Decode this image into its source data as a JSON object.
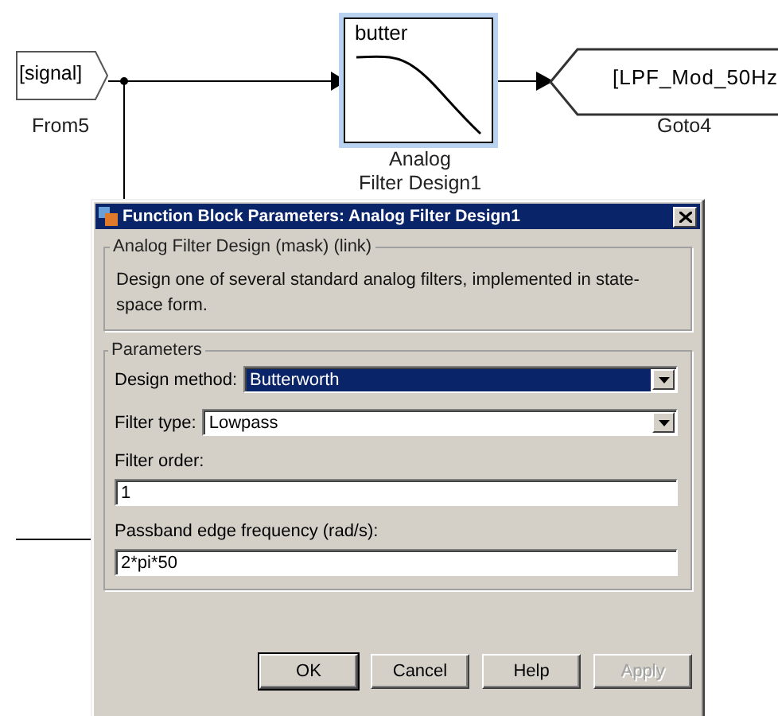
{
  "diagram": {
    "blocks": [
      {
        "kind": "from",
        "text": "[signal]",
        "caption": "From5",
        "selected": false
      },
      {
        "kind": "filter",
        "text": "butter",
        "caption": "Analog\nFilter Design1",
        "selected": true
      },
      {
        "kind": "goto",
        "text": "[LPF_Mod_50Hz",
        "caption": "Goto4",
        "selected": false
      }
    ]
  },
  "dialog": {
    "title": "Function Block Parameters: Analog Filter Design1",
    "description_group": {
      "title": "Analog Filter Design (mask) (link)",
      "text": "Design one of several standard analog filters, implemented in state-space form."
    },
    "parameters_group": {
      "title": "Parameters",
      "fields": [
        {
          "kind": "dropdown",
          "label": "Design method:",
          "value": "Butterworth",
          "focused": true
        },
        {
          "kind": "dropdown",
          "label": "Filter type:",
          "value": "Lowpass",
          "focused": false
        },
        {
          "kind": "text",
          "label": "Filter order:",
          "value": "1"
        },
        {
          "kind": "text",
          "label": "Passband edge frequency (rad/s):",
          "value": "2*pi*50"
        }
      ]
    },
    "buttons": [
      {
        "label": "OK",
        "disabled": false
      },
      {
        "label": "Cancel",
        "disabled": false
      },
      {
        "label": "Help",
        "disabled": false
      },
      {
        "label": "Apply",
        "disabled": true
      }
    ]
  }
}
